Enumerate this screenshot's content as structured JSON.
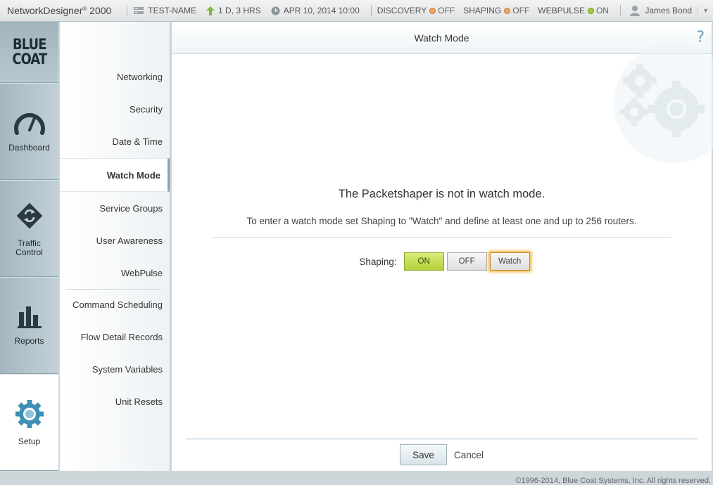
{
  "topbar": {
    "product": "NetworkDesigner",
    "product_mark": "®",
    "product_model": "2000",
    "device_name": "TEST-NAME",
    "uptime": "1 D, 3 HRS",
    "datetime": "APR 10, 2014 10:00",
    "discovery_label": "DISCOVERY",
    "discovery_state": "OFF",
    "shaping_label": "SHAPING",
    "shaping_state": "OFF",
    "webpulse_label": "WEBPULSE",
    "webpulse_state": "ON",
    "user": "James Bond"
  },
  "logo": {
    "line1": "BLUE",
    "line2": "COAT"
  },
  "leftnav": {
    "dashboard": "Dashboard",
    "traffic_line1": "Traffic",
    "traffic_line2": "Control",
    "reports": "Reports",
    "setup": "Setup"
  },
  "submenu": {
    "networking": "Networking",
    "security": "Security",
    "datetime": "Date & Time",
    "watchmode": "Watch Mode",
    "servicegroups": "Service Groups",
    "userawareness": "User Awareness",
    "webpulse": "WebPulse",
    "commandscheduling": "Command Scheduling",
    "flowdetail": "Flow Detail Records",
    "sysvars": "System Variables",
    "unitresets": "Unit Resets"
  },
  "main": {
    "title": "Watch Mode",
    "help": "?",
    "message": "The Packetshaper is not in watch mode.",
    "instruction": "To enter a watch mode set Shaping to \"Watch\" and define at least one and up to 256 routers.",
    "shaping_label": "Shaping:",
    "btn_on": "ON",
    "btn_off": "OFF",
    "btn_watch": "Watch",
    "selected_shaping": "Watch",
    "save": "Save",
    "cancel": "Cancel"
  },
  "footer": {
    "copyright": "©1996-2014, Blue Coat Systems, Inc. All rights reserved."
  },
  "colors": {
    "accent": "#7ba6bc",
    "on_green": "#b5d13a",
    "off_orange": "#f2a65a",
    "watch_glow": "#f4b43c"
  }
}
